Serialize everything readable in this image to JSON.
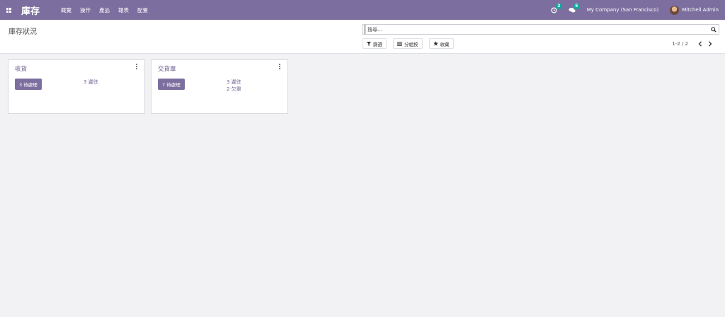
{
  "navbar": {
    "brand": "庫存",
    "menu": [
      "概覽",
      "操作",
      "產品",
      "報表",
      "配置"
    ],
    "activity_count": "2",
    "message_count": "5",
    "company": "My Company (San Francisco)",
    "user": "Mitchell Admin"
  },
  "control_panel": {
    "title": "庫存狀況",
    "search_placeholder": "搜尋...",
    "filters_label": "篩選",
    "group_by_label": "分組按",
    "favorites_label": "收藏",
    "pager_value": "1-2 / 2"
  },
  "cards": [
    {
      "title": "收貨",
      "todo": "3 待處理",
      "links": [
        "3 遲往"
      ]
    },
    {
      "title": "交貨單",
      "todo": "7 待處理",
      "links": [
        "3 遲往",
        "2 欠單"
      ]
    }
  ],
  "colors": {
    "brand": "#7c6f9f",
    "badge": "#11a9a1",
    "link": "#6f5e8f"
  }
}
